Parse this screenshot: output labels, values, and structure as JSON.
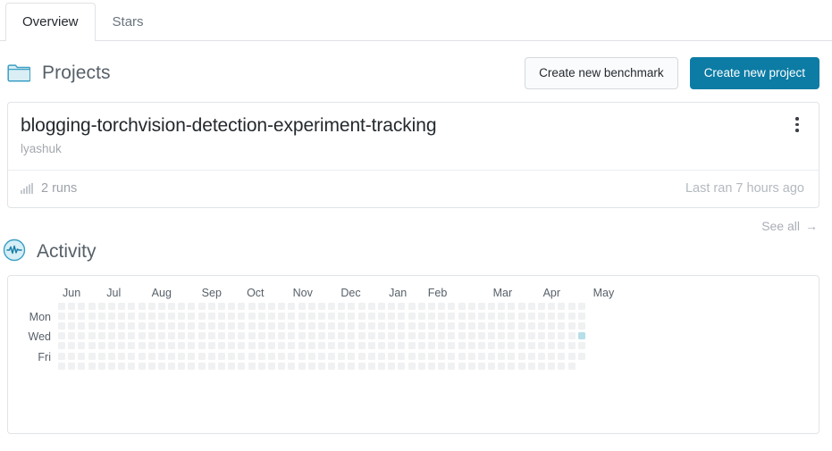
{
  "tabs": [
    {
      "label": "Overview",
      "active": true
    },
    {
      "label": "Stars",
      "active": false
    }
  ],
  "projects_section": {
    "icon": "folder-icon",
    "title": "Projects",
    "buttons": {
      "secondary_label": "Create new benchmark",
      "primary_label": "Create new project"
    },
    "see_all_label": "See all",
    "see_all_arrow": "→"
  },
  "project_card": {
    "title": "blogging-torchvision-detection-experiment-tracking",
    "owner": "lyashuk",
    "menu_icon": "kebab-menu-icon",
    "runs_icon": "bar-chart-icon",
    "runs_label": "2 runs",
    "last_ran_label": "Last ran 7 hours ago"
  },
  "activity_section": {
    "icon": "activity-pulse-icon",
    "title": "Activity"
  },
  "chart_data": {
    "type": "heatmap",
    "title": "Activity",
    "xlabel": "",
    "ylabel": "",
    "grid": false,
    "legend": "none",
    "month_labels": [
      "Jun",
      "Jul",
      "Aug",
      "Sep",
      "Oct",
      "Nov",
      "Dec",
      "Jan",
      "Feb",
      "Mar",
      "Apr",
      "May"
    ],
    "month_label_columns": [
      0,
      4.4,
      8.9,
      13.9,
      18.4,
      23.0,
      27.8,
      32.6,
      36.5,
      43.0,
      48.0,
      53.0
    ],
    "day_labels": [
      "",
      "Mon",
      "",
      "Wed",
      "",
      "Fri",
      ""
    ],
    "columns": 53,
    "rows": 7,
    "last_column_rows": 6,
    "cell_colors": [
      "#f0f1f2",
      "#b6dfe8"
    ],
    "highlighted_cells": [
      {
        "col": 52,
        "row": 3,
        "level": 1
      }
    ],
    "values_note": "All weeks empty (level 0) except one day in the final week at the Wednesday row (level 1)."
  },
  "colors": {
    "accent": "#0c7ca5",
    "border": "#e1e4e8",
    "tab_border": "#dfe2e5",
    "muted_text": "#9da3a9",
    "heat_empty": "#f0f1f2",
    "heat_level1": "#b6dfe8"
  }
}
